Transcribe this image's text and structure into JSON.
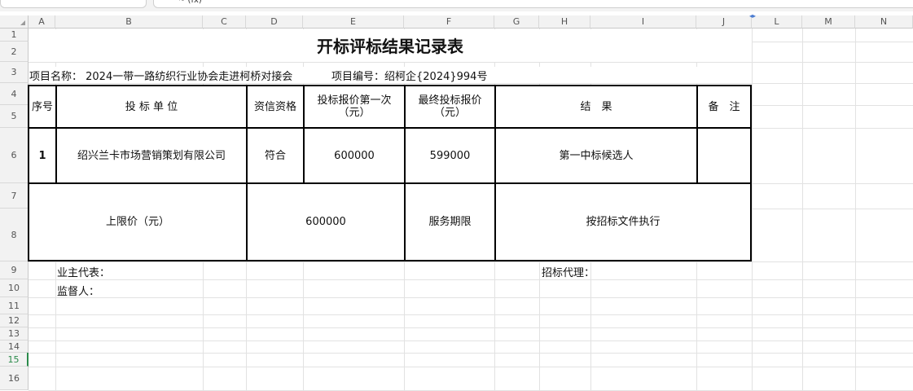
{
  "columns": [
    "A",
    "B",
    "C",
    "D",
    "E",
    "F",
    "G",
    "H",
    "I",
    "J",
    "L",
    "M",
    "N"
  ],
  "rows": [
    "1",
    "2",
    "3",
    "4",
    "5",
    "6",
    "7",
    "8",
    "9",
    "10",
    "11",
    "12",
    "13",
    "14",
    "15",
    "16"
  ],
  "selected_row": "15",
  "sheet": {
    "title": "开标评标结果记录表",
    "project_name": "项目名称： 2024一带一路纺织行业协会走进柯桥对接会",
    "project_no": "项目编号：绍柯企{2024}994号",
    "headers": {
      "seq": "序号",
      "bidder": "投 标 单 位",
      "qualification": "资信资格",
      "first_quote": "投标报价第一次（元）",
      "final_quote": "最终投标报价（元）",
      "result": "结　果",
      "remark": "备　注"
    },
    "row1": {
      "seq": "1",
      "bidder": "绍兴兰卡市场营销策划有限公司",
      "qualification": "符合",
      "first_quote": "600000",
      "final_quote": "599000",
      "result": "第一中标候选人",
      "remark": ""
    },
    "limit_label": "上限价（元）",
    "limit_value": "600000",
    "service_label": "服务期限",
    "service_value": "按招标文件执行",
    "owner_rep": "业主代表：",
    "agent": "招标代理：",
    "supervisor": "监督人："
  }
}
